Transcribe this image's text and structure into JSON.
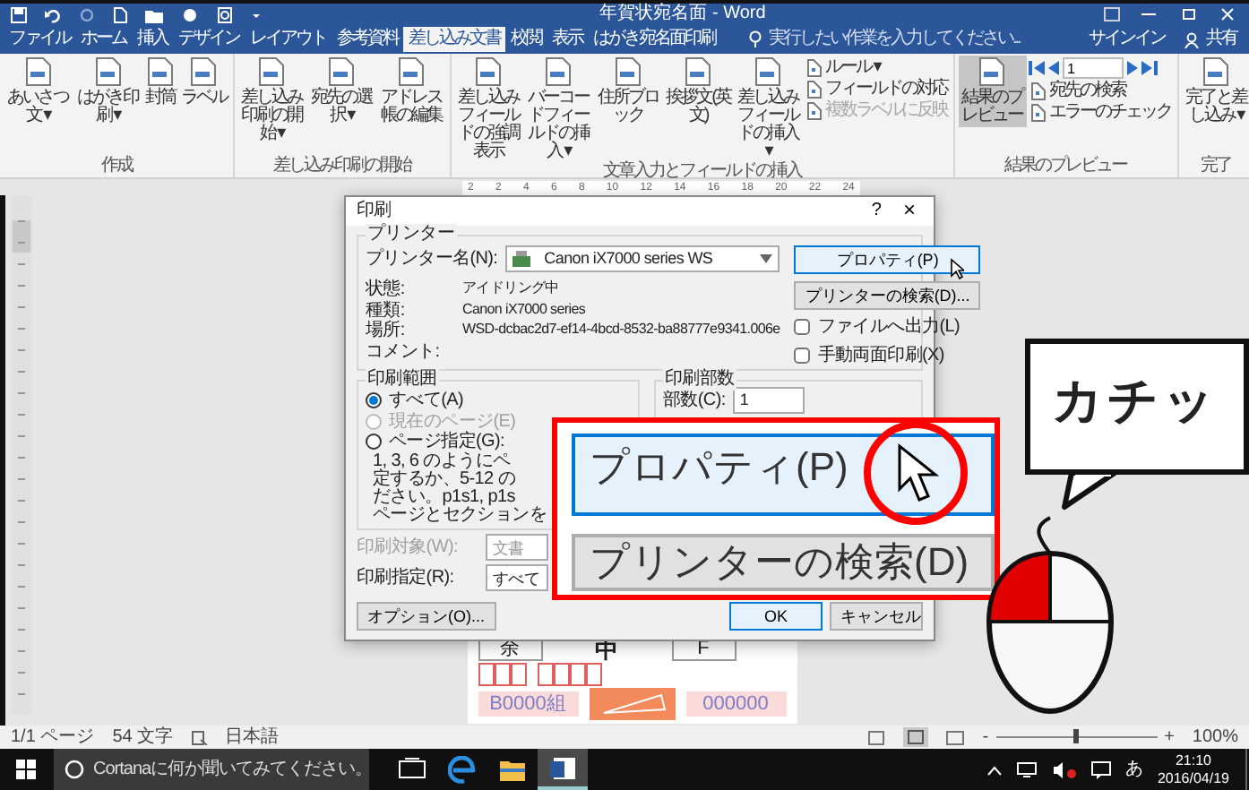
{
  "window": {
    "title": "年賀状宛名面 - Word"
  },
  "tabs": [
    {
      "label": "ファイル",
      "selected": false
    },
    {
      "label": "ホーム",
      "selected": false
    },
    {
      "label": "挿入",
      "selected": false
    },
    {
      "label": "デザイン",
      "selected": false
    },
    {
      "label": "レイアウト",
      "selected": false
    },
    {
      "label": "参考資料",
      "selected": false
    },
    {
      "label": "差し込み文書",
      "selected": true
    },
    {
      "label": "校閲",
      "selected": false
    },
    {
      "label": "表示",
      "selected": false
    },
    {
      "label": "はがき宛名面印刷",
      "selected": false
    }
  ],
  "tell_me": {
    "placeholder": "実行したい作業を入力してください..."
  },
  "account": {
    "sign_in": "サインイン",
    "share": "共有"
  },
  "ribbon": {
    "groups": [
      {
        "label": "作成",
        "items": [
          {
            "kind": "large",
            "label": "あいさつ文 ▾"
          },
          {
            "kind": "large",
            "label": "はがき印刷 ▾"
          },
          {
            "kind": "large",
            "label": "封筒"
          },
          {
            "kind": "large",
            "label": "ラベル"
          }
        ]
      },
      {
        "label": "差し込み印刷の開始",
        "items": [
          {
            "kind": "large",
            "label": "差し込み印刷の開始 ▾"
          },
          {
            "kind": "large",
            "label": "宛先の選択 ▾"
          },
          {
            "kind": "large",
            "label": "アドレス帳の編集"
          }
        ]
      },
      {
        "label": "文章入力とフィールドの挿入",
        "items": [
          {
            "kind": "large",
            "label": "差し込みフィールドの強調表示"
          },
          {
            "kind": "large",
            "label": "バーコードフィールドの挿入 ▾"
          },
          {
            "kind": "large",
            "label": "住所ブロック"
          },
          {
            "kind": "large",
            "label": "挨拶文(英文)"
          },
          {
            "kind": "large",
            "label": "差し込みフィールドの挿入 ▾"
          },
          {
            "kind": "stack",
            "items": [
              {
                "kind": "small",
                "label": "ルール ▾",
                "disabled": false
              },
              {
                "kind": "small",
                "label": "フィールドの対応",
                "disabled": false
              },
              {
                "kind": "small",
                "label": "複数ラベルに反映",
                "disabled": true
              }
            ]
          }
        ]
      },
      {
        "label": "結果のプレビュー",
        "items": [
          {
            "kind": "toggle",
            "label": "結果のプレビュー",
            "on": true
          },
          {
            "kind": "stack",
            "items": [
              {
                "kind": "nav",
                "value": "1"
              },
              {
                "kind": "small",
                "label": "宛先の検索",
                "disabled": false
              },
              {
                "kind": "small",
                "label": "エラーのチェック",
                "disabled": false
              }
            ]
          }
        ]
      },
      {
        "label": "完了",
        "items": [
          {
            "kind": "large",
            "label": "完了と差し込み ▾"
          }
        ]
      }
    ]
  },
  "ruler": {
    "labels": [
      "2",
      "2",
      "4",
      "6",
      "8",
      "10",
      "12",
      "14",
      "16",
      "18",
      "20",
      "22",
      "24"
    ]
  },
  "print_dialog": {
    "title": "印刷",
    "help": "?",
    "close": "×",
    "printer": {
      "legend": "プリンター",
      "name_label": "プリンター名(N):",
      "name_value": "Canon iX7000 series WS",
      "properties_button": "プロパティ(P)",
      "find_button": "プリンターの検索(D)...",
      "info": [
        {
          "label": "状態:",
          "value": "アイドリング中"
        },
        {
          "label": "種類:",
          "value": "Canon iX7000 series"
        },
        {
          "label": "場所:",
          "value": "WSD-dcbac2d7-ef14-4bcd-8532-ba88777e9341.006e"
        },
        {
          "label": "コメント:"
        }
      ],
      "options": [
        {
          "label": "ファイルへ出力(L)",
          "checked": false
        },
        {
          "label": "手動両面印刷(X)",
          "checked": false
        }
      ]
    },
    "range": {
      "legend": "印刷範囲",
      "choices": [
        {
          "label": "すべて(A)",
          "selected": true,
          "disabled": false
        },
        {
          "label": "現在のページ(E)",
          "selected": false,
          "disabled": true
        },
        {
          "label": "ページ指定(G):",
          "selected": false,
          "disabled": false
        }
      ],
      "hint_lines": [
        "1, 3, 6 のようにペ",
        "定するか、5-12 の",
        "ださい。p1s1, p1s",
        "ページとセクションを"
      ]
    },
    "print_what": {
      "label": "印刷対象(W):",
      "value": "文書",
      "disabled": true
    },
    "print_which": {
      "label": "印刷指定(R):",
      "value": "すべて",
      "disabled": false
    },
    "copies": {
      "legend": "印刷部数",
      "label": "部数(C):",
      "value": "1"
    },
    "buttons": {
      "options": "オプション(O)...",
      "ok": "OK",
      "cancel": "キャンセル"
    }
  },
  "postcard": {
    "cells": [
      "余",
      "中",
      "F"
    ],
    "group_code": "B0000組",
    "number": "000000"
  },
  "zoom_callout": {
    "buttons": [
      {
        "label": "プロパティ(P)",
        "hovered": true
      },
      {
        "label": "プリンターの検索(D)",
        "hovered": false
      }
    ]
  },
  "speech_bubble": {
    "text": "カチッ"
  },
  "status_bar": {
    "page": "1/1 ページ",
    "chars": "54 文字",
    "language": "日本語",
    "zoom_minus": "-",
    "zoom_plus": "+",
    "zoom_slider": {
      "level": 0.5
    },
    "zoom": "100%"
  },
  "taskbar": {
    "search_placeholder": "Cortanaに何か聞いてみてください。",
    "apps": [
      {
        "kind": "task-view",
        "selected": false
      },
      {
        "kind": "browser",
        "selected": false
      },
      {
        "kind": "folder",
        "selected": false
      },
      {
        "kind": "word",
        "selected": true
      }
    ],
    "ime": "あ",
    "time": "21:10",
    "date": "2016/04/19"
  }
}
